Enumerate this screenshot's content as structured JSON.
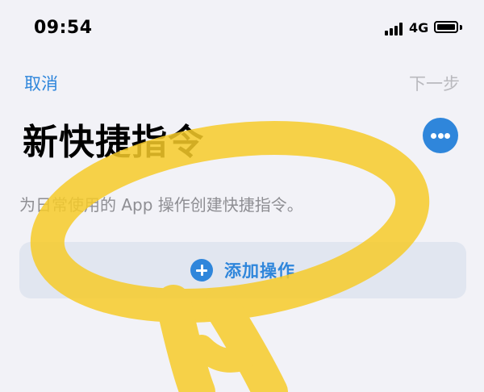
{
  "status_bar": {
    "time": "09:54",
    "network": "4G",
    "battery_level": 0.9
  },
  "nav": {
    "cancel": "取消",
    "next": "下一步"
  },
  "header": {
    "title": "新快捷指令",
    "more_icon": "ellipsis-icon"
  },
  "description": "为日常使用的 App 操作创建快捷指令。",
  "add_action": {
    "label": "添加操作",
    "icon": "plus-circle-icon"
  },
  "colors": {
    "accent": "#2f86db",
    "highlight": "#f7cc2a",
    "background": "#f2f2f7"
  }
}
